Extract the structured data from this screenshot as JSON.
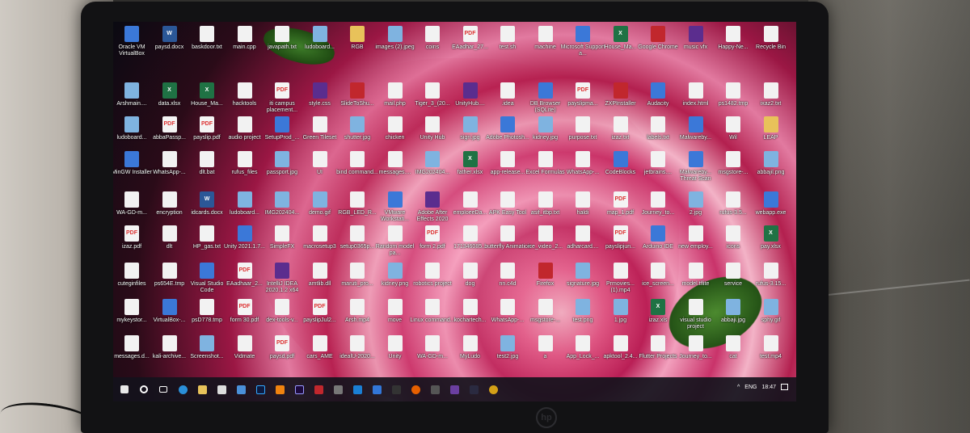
{
  "desktop_icons": [
    {
      "label": "Oracle VM VirtualBox",
      "kind": "exe"
    },
    {
      "label": "paysd.docx",
      "kind": "word"
    },
    {
      "label": "baskdoor.txt",
      "kind": "doc"
    },
    {
      "label": "main.cpp",
      "kind": "doc"
    },
    {
      "label": "javapath.txt",
      "kind": "doc"
    },
    {
      "label": "ludoboard...",
      "kind": "img"
    },
    {
      "label": "RGB",
      "kind": "fold"
    },
    {
      "label": "images (2).jpeg",
      "kind": "img"
    },
    {
      "label": "coins",
      "kind": "doc"
    },
    {
      "label": "EAadhar_27...",
      "kind": "pdf"
    },
    {
      "label": "test.sh",
      "kind": "doc"
    },
    {
      "label": "machine",
      "kind": "doc"
    },
    {
      "label": "Microsoft Support a...",
      "kind": "exe"
    },
    {
      "label": "House_Ma...",
      "kind": "xls"
    },
    {
      "label": "Google Chrome",
      "kind": "red"
    },
    {
      "label": "music vfx",
      "kind": "code"
    },
    {
      "label": "Happy-Ne...",
      "kind": "doc"
    },
    {
      "label": "Recycle Bin",
      "kind": "doc"
    },
    {
      "label": "Ob",
      "kind": "doc"
    },
    {
      "label": "Arshmain....",
      "kind": "img"
    },
    {
      "label": "data.xlsx",
      "kind": "xls"
    },
    {
      "label": "House_Ma...",
      "kind": "xls"
    },
    {
      "label": "hacktools",
      "kind": "doc"
    },
    {
      "label": "iti campus placement...",
      "kind": "pdf"
    },
    {
      "label": "style.css",
      "kind": "code"
    },
    {
      "label": "SlideToShu...",
      "kind": "red"
    },
    {
      "label": "mail.php",
      "kind": "doc"
    },
    {
      "label": "Tiger_3_(20...",
      "kind": "doc"
    },
    {
      "label": "UnityHub....",
      "kind": "code"
    },
    {
      "label": ".idea",
      "kind": "doc"
    },
    {
      "label": "DB Browser (SQLite)",
      "kind": "exe"
    },
    {
      "label": "payslipma...",
      "kind": "pdf"
    },
    {
      "label": "ZXPInstaller",
      "kind": "red"
    },
    {
      "label": "Audacity",
      "kind": "exe"
    },
    {
      "label": "index.html",
      "kind": "doc"
    },
    {
      "label": "ps1482.tmp",
      "kind": "doc"
    },
    {
      "label": "ixaz2.txt",
      "kind": "doc"
    },
    {
      "label": "le",
      "kind": "doc"
    },
    {
      "label": "ludoboard...",
      "kind": "img"
    },
    {
      "label": "abbaPassp...",
      "kind": "pdf"
    },
    {
      "label": "payslip.pdf",
      "kind": "pdf"
    },
    {
      "label": "audio project",
      "kind": "doc"
    },
    {
      "label": "SetupProd_...",
      "kind": "exe"
    },
    {
      "label": "Green Tileset",
      "kind": "doc"
    },
    {
      "label": "shutter.jpg",
      "kind": "img"
    },
    {
      "label": "chicken",
      "kind": "doc"
    },
    {
      "label": "Unity Hub",
      "kind": "doc"
    },
    {
      "label": "sign.jpg",
      "kind": "img"
    },
    {
      "label": "Adobe Photosh...",
      "kind": "exe"
    },
    {
      "label": "kidney.jpg",
      "kind": "img"
    },
    {
      "label": "purpose.txt",
      "kind": "doc"
    },
    {
      "label": "izaz.txt",
      "kind": "doc"
    },
    {
      "label": "labels.txt",
      "kind": "doc"
    },
    {
      "label": "Malwareby...",
      "kind": "exe"
    },
    {
      "label": "Wil",
      "kind": "doc"
    },
    {
      "label": "LEAP",
      "kind": "fold"
    },
    {
      "label": "M A",
      "kind": "doc"
    },
    {
      "label": "MinGW Installer",
      "kind": "exe"
    },
    {
      "label": "WhatsApp-...",
      "kind": "doc"
    },
    {
      "label": "dlt.bat",
      "kind": "doc"
    },
    {
      "label": "rufus_files",
      "kind": "doc"
    },
    {
      "label": "passport.jpg",
      "kind": "img"
    },
    {
      "label": "UI",
      "kind": "doc"
    },
    {
      "label": "bind command...",
      "kind": "doc"
    },
    {
      "label": "messages....",
      "kind": "doc"
    },
    {
      "label": "IMG202404...",
      "kind": "img"
    },
    {
      "label": "father.xlsx",
      "kind": "xls"
    },
    {
      "label": "app-release...",
      "kind": "doc"
    },
    {
      "label": "Excel Formulas",
      "kind": "doc"
    },
    {
      "label": "WhatsApp-...",
      "kind": "doc"
    },
    {
      "label": "CodeBlocks",
      "kind": "exe"
    },
    {
      "label": "jetbrains....",
      "kind": "doc"
    },
    {
      "label": "Malwareby... Threat Scan",
      "kind": "exe"
    },
    {
      "label": "msgstore-...",
      "kind": "doc"
    },
    {
      "label": "abbajil.png",
      "kind": "img"
    },
    {
      "label": "WA-GD-m...",
      "kind": "doc"
    },
    {
      "label": "encryption",
      "kind": "doc"
    },
    {
      "label": "idcards.docx",
      "kind": "word"
    },
    {
      "label": "ludoboard...",
      "kind": "img"
    },
    {
      "label": "IMG202404...",
      "kind": "img"
    },
    {
      "label": "demo.gif",
      "kind": "img"
    },
    {
      "label": "RGB_LED_R...",
      "kind": "doc"
    },
    {
      "label": "VMware Workstati...",
      "kind": "exe"
    },
    {
      "label": "Adobe After Effects 2020",
      "kind": "code"
    },
    {
      "label": "emploeeDa...",
      "kind": "doc"
    },
    {
      "label": "APK Easy Tool",
      "kind": "doc"
    },
    {
      "label": "asif_itbp.txt",
      "kind": "doc"
    },
    {
      "label": "haldi",
      "kind": "doc"
    },
    {
      "label": "map_1.pdf",
      "kind": "pdf"
    },
    {
      "label": "Journey_to...",
      "kind": "doc"
    },
    {
      "label": "2.jpg",
      "kind": "img"
    },
    {
      "label": "rufus-3.5...",
      "kind": "doc"
    },
    {
      "label": "webapp.exe",
      "kind": "exe"
    },
    {
      "label": "m",
      "kind": "doc"
    },
    {
      "label": "izaz.pdf",
      "kind": "pdf"
    },
    {
      "label": "dlt",
      "kind": "doc"
    },
    {
      "label": "HP_gas.txt",
      "kind": "doc"
    },
    {
      "label": "Unity 2021.1.7...",
      "kind": "exe"
    },
    {
      "label": "SimpleFX",
      "kind": "doc"
    },
    {
      "label": "macrosetup3",
      "kind": "doc"
    },
    {
      "label": "setup0365p...",
      "kind": "doc"
    },
    {
      "label": "Random model pa...",
      "kind": "doc"
    },
    {
      "label": "form 2.pdf",
      "kind": "pdf"
    },
    {
      "label": "171346085...",
      "kind": "doc"
    },
    {
      "label": "butterfly Animation",
      "kind": "doc"
    },
    {
      "label": "ice_video_2...",
      "kind": "doc"
    },
    {
      "label": "adharcard....",
      "kind": "doc"
    },
    {
      "label": "payslipjun...",
      "kind": "pdf"
    },
    {
      "label": "Arduino IDE",
      "kind": "exe"
    },
    {
      "label": "new employ...",
      "kind": "doc"
    },
    {
      "label": "icons",
      "kind": "doc"
    },
    {
      "label": "pay.xlsx",
      "kind": "xls"
    },
    {
      "label": "cuteginfiles",
      "kind": "doc"
    },
    {
      "label": "ps654E.tmp",
      "kind": "doc"
    },
    {
      "label": "Visual Studio Code",
      "kind": "exe"
    },
    {
      "label": "EAadhaar_2...",
      "kind": "pdf"
    },
    {
      "label": "IntelliJ IDEA 2020.1.2 x64",
      "kind": "code"
    },
    {
      "label": "amtlib.dll",
      "kind": "doc"
    },
    {
      "label": "maruti_pro...",
      "kind": "doc"
    },
    {
      "label": "kidney.png",
      "kind": "img"
    },
    {
      "label": "robotics project",
      "kind": "doc"
    },
    {
      "label": "dog",
      "kind": "doc"
    },
    {
      "label": "nn.c4d",
      "kind": "doc"
    },
    {
      "label": "Firefox",
      "kind": "red"
    },
    {
      "label": "signature.jpg",
      "kind": "img"
    },
    {
      "label": "Prmovies... (1).mp4",
      "kind": "doc"
    },
    {
      "label": "ice_screen...",
      "kind": "doc"
    },
    {
      "label": "model.tflite",
      "kind": "doc"
    },
    {
      "label": "service",
      "kind": "doc"
    },
    {
      "label": "rufus-3.15...",
      "kind": "doc"
    },
    {
      "label": "mykeystor...",
      "kind": "doc"
    },
    {
      "label": "VirtualBox-...",
      "kind": "exe"
    },
    {
      "label": "psD778.tmp",
      "kind": "doc"
    },
    {
      "label": "form 30.pdf",
      "kind": "pdf"
    },
    {
      "label": "dex-tools-v...",
      "kind": "doc"
    },
    {
      "label": "payslipJul2...",
      "kind": "pdf"
    },
    {
      "label": "Arsh.mp4",
      "kind": "doc"
    },
    {
      "label": "move",
      "kind": "doc"
    },
    {
      "label": "Linux command...",
      "kind": "doc"
    },
    {
      "label": "kochartech...",
      "kind": "doc"
    },
    {
      "label": "WhatsApp-...",
      "kind": "doc"
    },
    {
      "label": "msgstore-...",
      "kind": "doc"
    },
    {
      "label": "test.png",
      "kind": "img"
    },
    {
      "label": "1.jpg",
      "kind": "img"
    },
    {
      "label": "izaz.xls",
      "kind": "xls"
    },
    {
      "label": "visual studio project",
      "kind": "doc"
    },
    {
      "label": "abbaji.jpg",
      "kind": "img"
    },
    {
      "label": "sphy.gif",
      "kind": "img"
    },
    {
      "label": "messages.d...",
      "kind": "doc"
    },
    {
      "label": "kali-archive...",
      "kind": "doc"
    },
    {
      "label": "Screenshot...",
      "kind": "img"
    },
    {
      "label": "Vidmate",
      "kind": "doc"
    },
    {
      "label": "paysd.pdf",
      "kind": "pdf"
    },
    {
      "label": "cars_AME",
      "kind": "doc"
    },
    {
      "label": "idealU-2020...",
      "kind": "doc"
    },
    {
      "label": "Unity",
      "kind": "doc"
    },
    {
      "label": "WA-GD-m...",
      "kind": "doc"
    },
    {
      "label": "MyLudo",
      "kind": "doc"
    },
    {
      "label": "test2.jpg",
      "kind": "img"
    },
    {
      "label": "a",
      "kind": "doc"
    },
    {
      "label": "App_Lock_...",
      "kind": "doc"
    },
    {
      "label": "apktool_2.4...",
      "kind": "doc"
    },
    {
      "label": "Flutter Projects",
      "kind": "doc"
    },
    {
      "label": "Journey_to...",
      "kind": "doc"
    },
    {
      "label": "cat",
      "kind": "doc"
    },
    {
      "label": "test.mp4",
      "kind": "doc"
    }
  ],
  "taskbar": {
    "tray_lang": "ENG",
    "tray_time": "18:47",
    "tray_caret": "^"
  },
  "brand": {
    "logo": "hp"
  }
}
